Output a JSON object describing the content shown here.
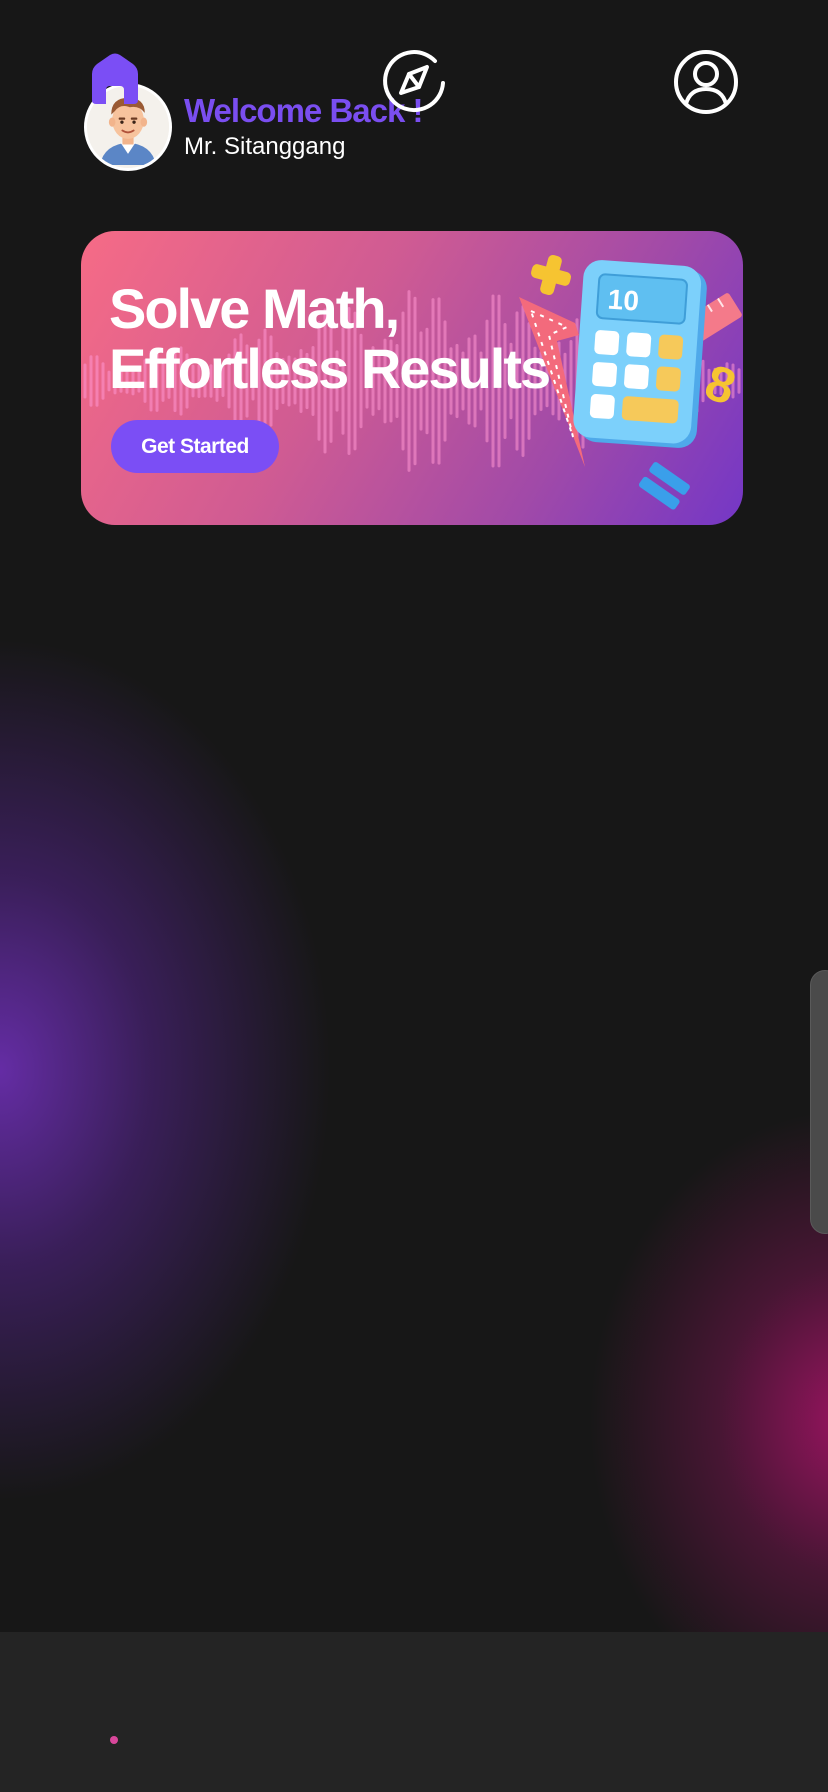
{
  "header": {
    "welcome_text": "Welcome Back !",
    "username": "Mr. Sitanggang"
  },
  "banner": {
    "title_line1": "Solve Math,",
    "title_line2": "Effortless Results",
    "cta_label": "Get Started",
    "calculator_display": "10",
    "floating_number": "8"
  },
  "bottom_nav": {
    "items": [
      {
        "name": "home",
        "icon": "home-icon",
        "active": true
      },
      {
        "name": "explore",
        "icon": "compass-icon",
        "active": false
      },
      {
        "name": "profile",
        "icon": "user-icon",
        "active": false
      }
    ]
  },
  "colors": {
    "accent": "#7b4ef5",
    "background": "#171717",
    "nav_background": "#242424",
    "active_dot": "#d9479b"
  }
}
